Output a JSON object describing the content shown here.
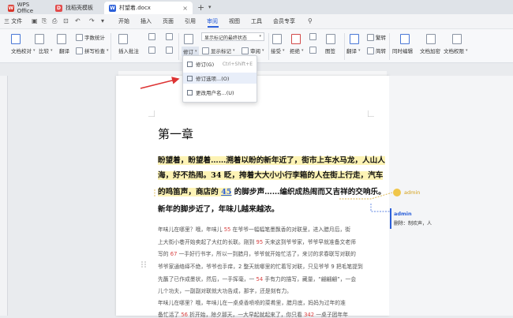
{
  "tabs": [
    {
      "label": "WPS Office",
      "logo": "W"
    },
    {
      "label": "找稻壳模板",
      "logo": "D"
    },
    {
      "label": "村望着.docx",
      "logo": "W"
    }
  ],
  "new_tab": "+",
  "menu": {
    "file": "三 文件",
    "items": [
      "开始",
      "插入",
      "页面",
      "引用",
      "审阅",
      "视图",
      "工具",
      "会员专享"
    ],
    "active": "审阅"
  },
  "ribbon": {
    "doc_proof": "文档校对",
    "compare": "比较",
    "translate": "翻译",
    "word_count": "字数统计",
    "spell_check": "拼写检查",
    "insert_comment": "插入批注",
    "revise": "修订",
    "show_markup": "显示标记",
    "review": "审阅",
    "status_select": "显示标记的最终状态",
    "accept": "接受",
    "reject": "拒绝",
    "protect": "限制",
    "restrict": "图签",
    "translate2": "翻译",
    "simp_trad": "繁转",
    "sim": "简转",
    "same_edit": "同时编辑",
    "doc_encrypt": "文档加密",
    "doc_permission": "文档权限"
  },
  "dropdown": {
    "items": [
      {
        "label": "修订(G)",
        "shortcut": "Ctrl+Shift+E"
      },
      {
        "label": "修订选项...(O)",
        "shortcut": ""
      },
      {
        "label": "更改用户名...(U)",
        "shortcut": ""
      }
    ]
  },
  "document": {
    "heading": "第一章",
    "highlight_lines": [
      [
        "盼望着，盼望着……溯着以盼的新年近了，街市上车水马龙，人山人",
        ""
      ],
      [
        "海，好不热闹。34 眨，挎着大大小小行李箱的人在街上行走，汽车",
        ""
      ],
      [
        "的鸣笛声，商店的 ",
        "45",
        " 的脚步声……编织成热闹而又吉祥的交响乐。"
      ],
      [
        "新年的脚步近了，年味儿越来越浓。",
        ""
      ]
    ],
    "body_lines": [
      [
        "年味儿在哪里？哦，年味儿 ",
        "55",
        " 在爷爷一幅幅笔墨飘香的对联里，进入腊月后，街"
      ],
      [
        "上大街小巷开始卖起了大红的长联。刚到 ",
        "95",
        " 天来这到爷爷家，爷爷早就准备文老师"
      ],
      [
        "写的 ",
        "67",
        " 一手好行书字，所以一到腊月，爷爷就开始忙活了，来讨的求春联写对联的"
      ],
      [
        "爷爷家通络绎不绝，爷爷也手痒，2 整天就哪里的忙着写对联，只见爷爷 9 把毛笔提到"
      ],
      [
        "先蘸了已作成墨状，然后，一手挥毫，一 ",
        "54",
        " 手有力的描写，藏量，“翩翩翩”，一会"
      ],
      [
        "儿个功夫，一副副对联就大功告成，那字，还是刻有力。",
        ""
      ],
      [
        "年味儿在哪里？哦，年味儿在一桌桌香喷喷的菜肴里，腊月底，妈妈为过年的准"
      ],
      [
        "备忙活了 ",
        "56",
        " 折开始，除夕那天，一大早起就起来了，你只看 ",
        "342",
        " 一桌子团年年"
      ]
    ]
  },
  "comments": [
    {
      "author": "admin",
      "text": ""
    },
    {
      "author": "admin",
      "text": "删除：制欢声，人"
    }
  ]
}
